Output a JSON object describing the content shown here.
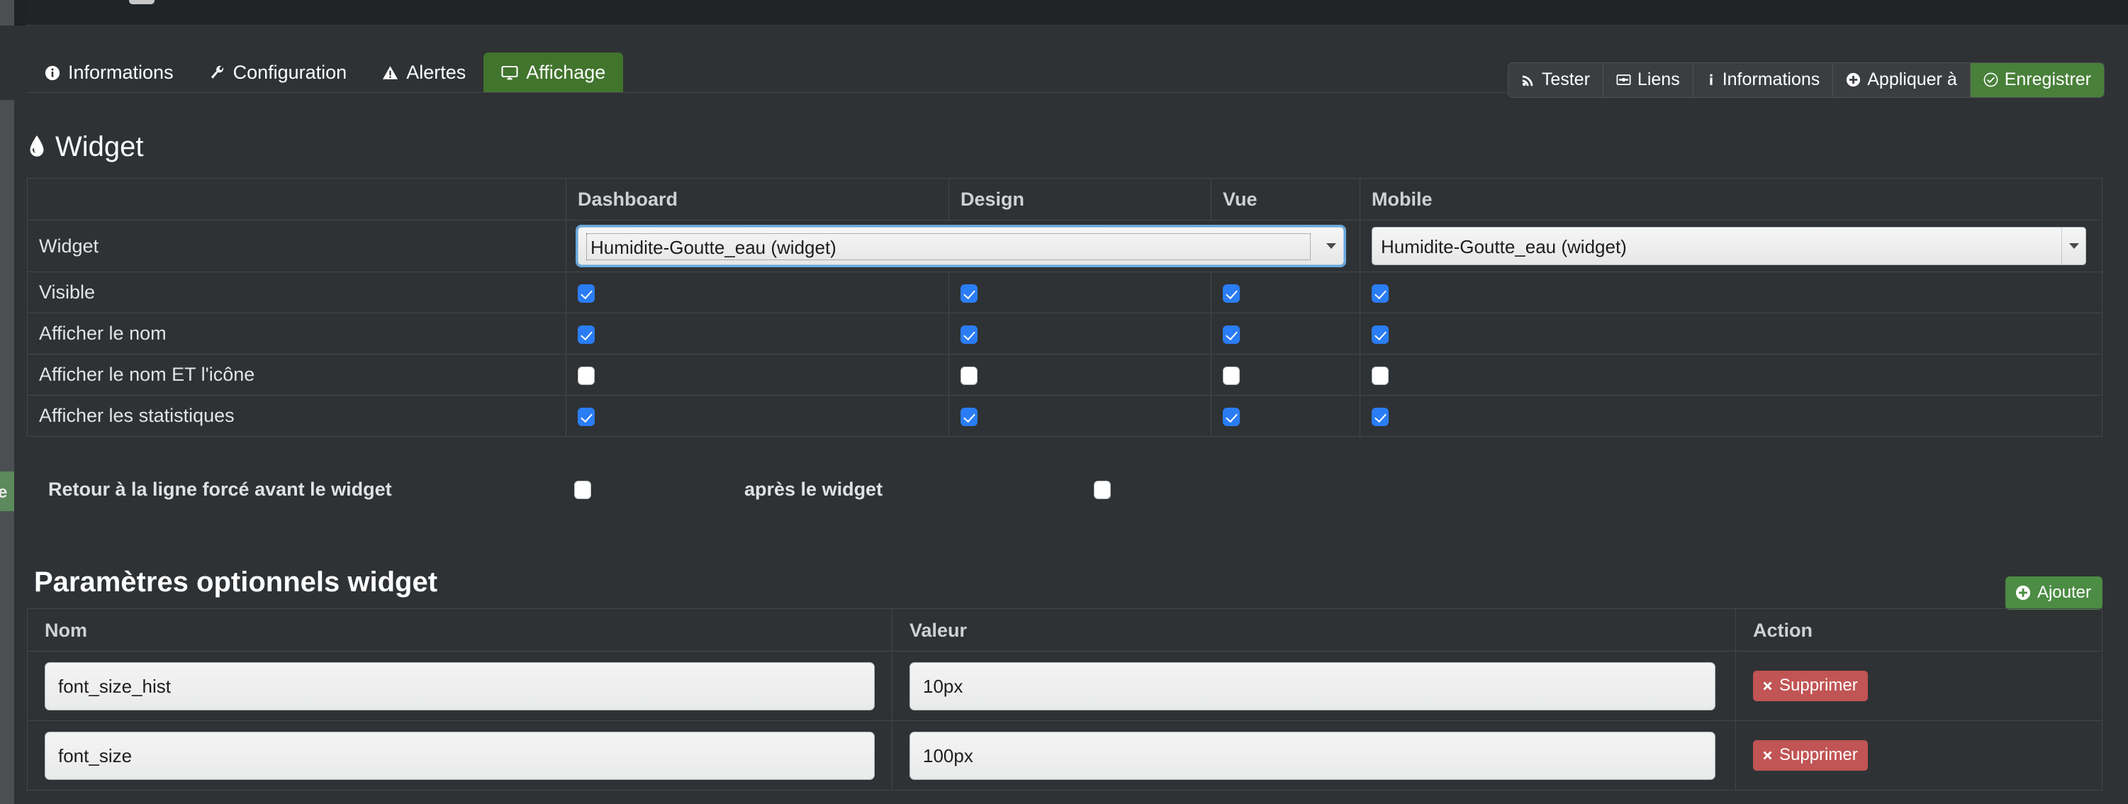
{
  "tabs": [
    {
      "label": "Informations",
      "icon": "info-circle-icon",
      "active": false
    },
    {
      "label": "Configuration",
      "icon": "wrench-icon",
      "active": false
    },
    {
      "label": "Alertes",
      "icon": "warning-triangle-icon",
      "active": false
    },
    {
      "label": "Affichage",
      "icon": "desktop-icon",
      "active": true
    }
  ],
  "toolbar": {
    "tester": "Tester",
    "liens": "Liens",
    "informations": "Informations",
    "appliquer": "Appliquer à",
    "enregistrer": "Enregistrer"
  },
  "widget_section": {
    "title": "Widget",
    "icon": "tint-droplet-icon",
    "columns": [
      "",
      "Dashboard",
      "Design",
      "Vue",
      "Mobile"
    ],
    "select_row": {
      "label": "Widget",
      "dashboard_value": "Humidite-Goutte_eau (widget)",
      "design_value": "",
      "vue_value": "",
      "mobile_value": "Humidite-Goutte_eau (widget)"
    },
    "rows": [
      {
        "label": "Visible",
        "dashboard": true,
        "design": true,
        "vue": true,
        "mobile": true
      },
      {
        "label": "Afficher le nom",
        "dashboard": true,
        "design": true,
        "vue": true,
        "mobile": true
      },
      {
        "label": "Afficher le nom ET l'icône",
        "dashboard": false,
        "design": false,
        "vue": false,
        "mobile": false
      },
      {
        "label": "Afficher les statistiques",
        "dashboard": true,
        "design": true,
        "vue": true,
        "mobile": true
      }
    ],
    "linebreak": {
      "before_label": "Retour à la ligne forcé avant le widget",
      "before_checked": false,
      "after_label": "après le widget",
      "after_checked": false
    }
  },
  "params_section": {
    "title": "Paramètres optionnels widget",
    "add_label": "Ajouter",
    "columns": [
      "Nom",
      "Valeur",
      "Action"
    ],
    "rows": [
      {
        "nom": "font_size_hist",
        "valeur": "10px",
        "action": "Supprimer"
      },
      {
        "nom": "font_size",
        "valeur": "100px",
        "action": "Supprimer"
      }
    ]
  },
  "colors": {
    "background": "#2f3235",
    "accent_green": "#41742d",
    "button_green": "#4c8c44",
    "danger_red": "#c15454",
    "checkbox_blue": "#2a7df5",
    "focus_blue": "#69a8db"
  },
  "gutter_ghost_text": "e"
}
